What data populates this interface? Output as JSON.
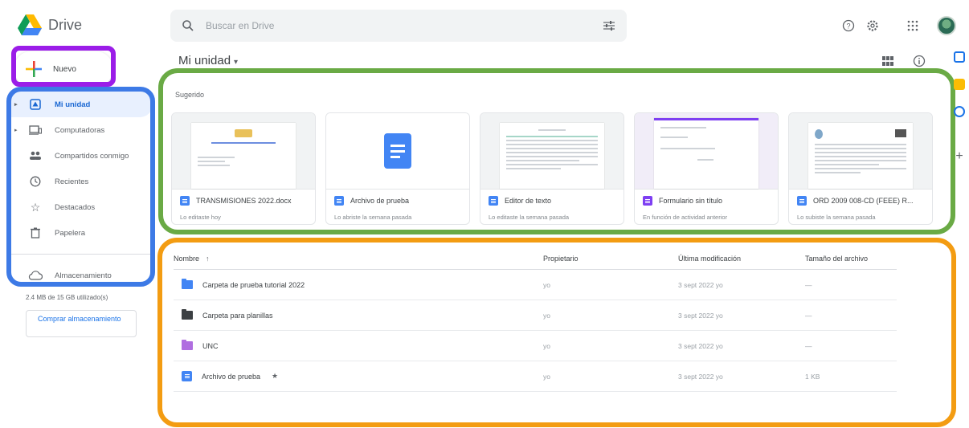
{
  "app": {
    "name": "Drive"
  },
  "search": {
    "placeholder": "Buscar en Drive"
  },
  "sidebar": {
    "new_label": "Nuevo",
    "items": [
      {
        "label": "Mi unidad",
        "icon": "my-drive-icon",
        "active": true,
        "arrow": true
      },
      {
        "label": "Computadoras",
        "icon": "computer-icon",
        "active": false,
        "arrow": true
      },
      {
        "label": "Compartidos conmigo",
        "icon": "shared-icon",
        "active": false,
        "arrow": false
      },
      {
        "label": "Recientes",
        "icon": "clock-icon",
        "active": false,
        "arrow": false
      },
      {
        "label": "Destacados",
        "icon": "star-icon",
        "active": false,
        "arrow": false
      },
      {
        "label": "Papelera",
        "icon": "trash-icon",
        "active": false,
        "arrow": false
      }
    ],
    "storage_label": "Almacenamiento",
    "storage_used": "2.4 MB de 15 GB utilizado(s)",
    "buy_storage": "Comprar almacenamiento"
  },
  "main": {
    "title": "Mi unidad",
    "suggested_title": "Sugerido"
  },
  "suggested": [
    {
      "name": "TRANSMISIONES 2022.docx",
      "sub": "Lo editaste hoy",
      "icon_color": "#4285f4"
    },
    {
      "name": "Archivo de prueba",
      "sub": "Lo abriste la semana pasada",
      "icon_color": "#4285f4"
    },
    {
      "name": "Editor de texto",
      "sub": "Lo editaste la semana pasada",
      "icon_color": "#4285f4"
    },
    {
      "name": "Formulario sin título",
      "sub": "En función de actividad anterior",
      "icon_color": "#7e3ff2"
    },
    {
      "name": "ORD 2009 008-CD (FEEE) R...",
      "sub": "Lo subiste la semana pasada",
      "icon_color": "#4285f4"
    }
  ],
  "table": {
    "headers": {
      "name": "Nombre",
      "owner": "Propietario",
      "modified": "Última modificación",
      "size": "Tamaño del archivo"
    },
    "rows": [
      {
        "name": "Carpeta de prueba tutorial 2022",
        "owner": "yo",
        "modified": "3 sept 2022 yo",
        "size": "—",
        "type": "folder-shared",
        "color": "#4285f4"
      },
      {
        "name": "Carpeta para planillas",
        "owner": "yo",
        "modified": "3 sept 2022 yo",
        "size": "—",
        "type": "folder",
        "color": "#3c4043"
      },
      {
        "name": "UNC",
        "owner": "yo",
        "modified": "3 sept 2022 yo",
        "size": "—",
        "type": "folder",
        "color": "#b06ee0"
      },
      {
        "name": "Archivo de prueba",
        "owner": "yo",
        "modified": "3 sept 2022 yo",
        "size": "1 KB",
        "type": "doc",
        "color": "#4285f4",
        "starred": true
      }
    ]
  },
  "colors": {
    "annotation_purple": "#9b1de8",
    "annotation_blue": "#3d7ae6",
    "annotation_green": "#6aaa45",
    "annotation_orange": "#f39c12"
  }
}
